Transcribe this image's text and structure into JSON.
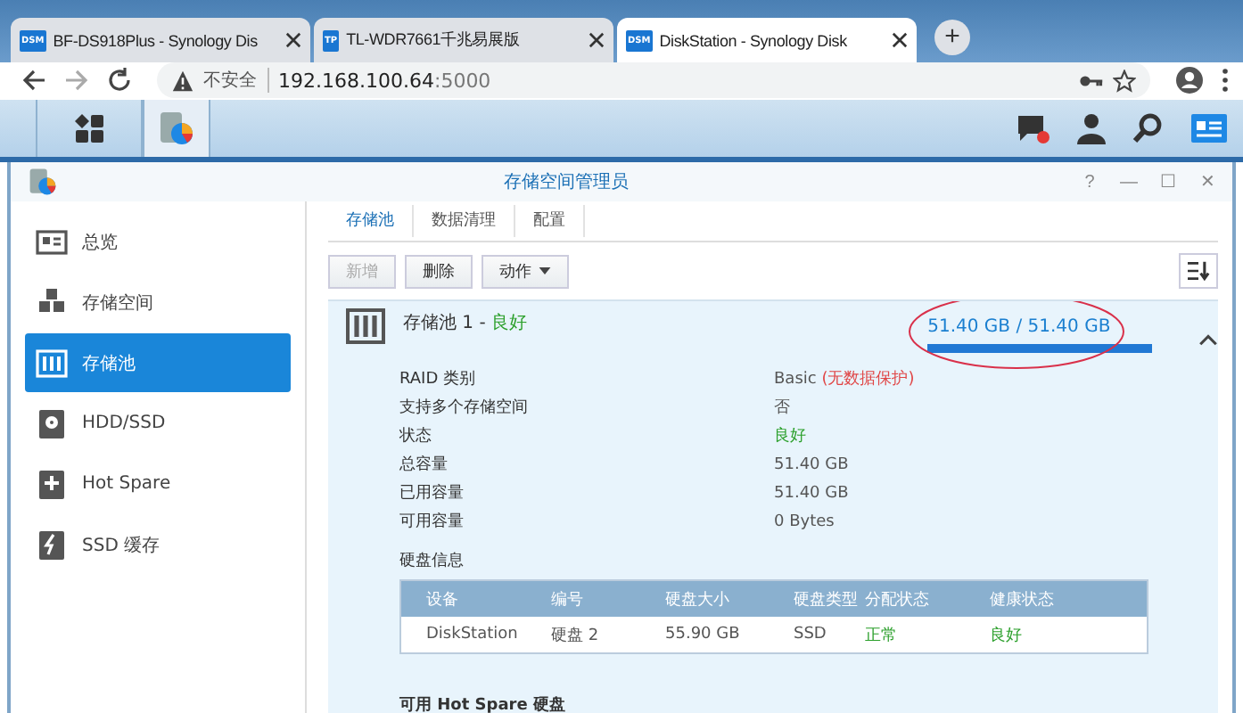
{
  "browser": {
    "tabs": [
      {
        "title": "BF-DS918Plus - Synology Dis",
        "badge": "DSM",
        "selected": false
      },
      {
        "title": "TL-WDR7661千兆易展版",
        "badge": "TP",
        "selected": false
      },
      {
        "title": "DiskStation - Synology Disk",
        "badge": "DSM",
        "selected": true
      }
    ],
    "new_tab": "+",
    "security": "不安全",
    "url_host": "192.168.100.64",
    "url_port": ":5000"
  },
  "window": {
    "title": "存储空间管理员",
    "controls": [
      "?",
      "—",
      "☐",
      "✕"
    ]
  },
  "sidebar": {
    "items": [
      {
        "label": "总览",
        "selected": false
      },
      {
        "label": "存储空间",
        "selected": false
      },
      {
        "label": "存储池",
        "selected": true
      },
      {
        "label": "HDD/SSD",
        "selected": false
      },
      {
        "label": "Hot Spare",
        "selected": false
      },
      {
        "label": "SSD 缓存",
        "selected": false
      }
    ]
  },
  "tabs": [
    {
      "label": "存储池",
      "selected": true
    },
    {
      "label": "数据清理",
      "selected": false
    },
    {
      "label": "配置",
      "selected": false
    }
  ],
  "toolbar": {
    "buttons": [
      {
        "label": "新增",
        "disabled": true,
        "dropdown": false
      },
      {
        "label": "删除",
        "disabled": false,
        "dropdown": false
      },
      {
        "label": "动作",
        "disabled": false,
        "dropdown": true
      }
    ]
  },
  "pool": {
    "name": "存储池 1 - ",
    "status": "良好",
    "usage": "51.40 GB / 51.40 GB",
    "level": 1.0,
    "expanded": true,
    "details": [
      {
        "label": "RAID 类别",
        "value": "Basic ",
        "note": "(无数据保护)",
        "kind": "warn"
      },
      {
        "label": "支持多个存储空间",
        "value": "否",
        "kind": "plain"
      },
      {
        "label": "状态",
        "value": "良好",
        "kind": "good"
      },
      {
        "label": "总容量",
        "value": "51.40 GB",
        "kind": "plain"
      },
      {
        "label": "已用容量",
        "value": "51.40 GB",
        "kind": "plain"
      },
      {
        "label": "可用容量",
        "value": "0 Bytes",
        "kind": "plain"
      }
    ],
    "disk_info": {
      "title": "硬盘信息",
      "columns": [
        "设备",
        "编号",
        "硬盘大小",
        "硬盘类型",
        "分配状态",
        "健康状态"
      ],
      "rows": [
        [
          {
            "text": "DiskStation",
            "kind": "plain"
          },
          {
            "text": "硬盘 2",
            "kind": "plain"
          },
          {
            "text": "55.90 GB",
            "kind": "plain"
          },
          {
            "text": "SSD",
            "kind": "plain"
          },
          {
            "text": "正常",
            "kind": "good"
          },
          {
            "text": "良好",
            "kind": "good"
          }
        ]
      ]
    },
    "hot_spare": {
      "title": "可用 Hot Spare 硬盘"
    }
  }
}
